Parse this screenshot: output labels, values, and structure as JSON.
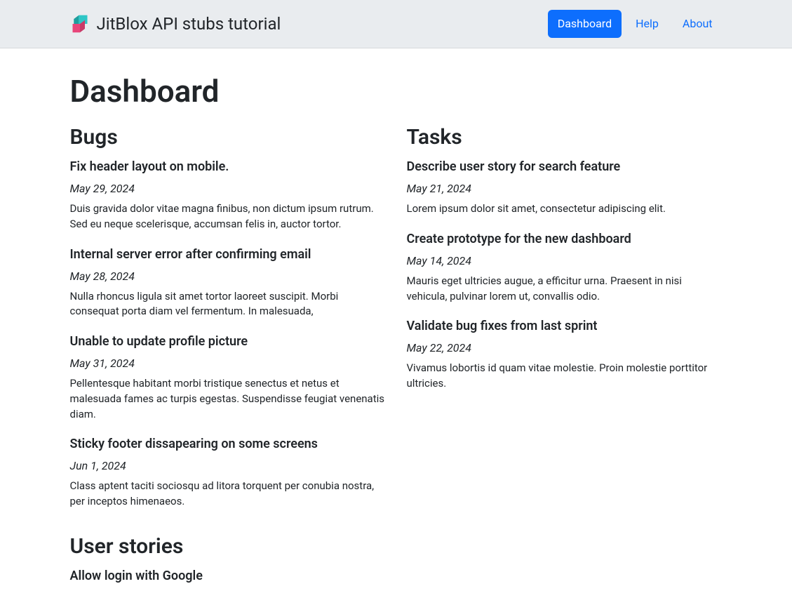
{
  "header": {
    "brand": "JitBlox API stubs tutorial",
    "nav": {
      "dashboard": "Dashboard",
      "help": "Help",
      "about": "About"
    }
  },
  "page": {
    "title": "Dashboard"
  },
  "sections": {
    "bugs": {
      "heading": "Bugs",
      "items": [
        {
          "title": "Fix header layout on mobile.",
          "date": "May 29, 2024",
          "desc": "Duis gravida dolor vitae magna finibus, non dictum ipsum rutrum. Sed eu neque scelerisque, accumsan felis in, auctor tortor."
        },
        {
          "title": "Internal server error after confirming email",
          "date": "May 28, 2024",
          "desc": "Nulla rhoncus ligula sit amet tortor laoreet suscipit. Morbi consequat porta diam vel fermentum. In malesuada,"
        },
        {
          "title": "Unable to update profile picture",
          "date": "May 31, 2024",
          "desc": "Pellentesque habitant morbi tristique senectus et netus et malesuada fames ac turpis egestas. Suspendisse feugiat venenatis diam."
        },
        {
          "title": "Sticky footer dissapearing on some screens",
          "date": "Jun 1, 2024",
          "desc": "Class aptent taciti sociosqu ad litora torquent per conubia nostra, per inceptos himenaeos."
        }
      ]
    },
    "user_stories": {
      "heading": "User stories",
      "items": [
        {
          "title": "Allow login with Google",
          "date": "",
          "desc": ""
        }
      ]
    },
    "tasks": {
      "heading": "Tasks",
      "items": [
        {
          "title": "Describe user story for search feature",
          "date": "May 21, 2024",
          "desc": "Lorem ipsum dolor sit amet, consectetur adipiscing elit."
        },
        {
          "title": "Create prototype for the new dashboard",
          "date": "May 14, 2024",
          "desc": "Mauris eget ultricies augue, a efficitur urna. Praesent in nisi vehicula, pulvinar lorem ut, convallis odio."
        },
        {
          "title": "Validate bug fixes from last sprint",
          "date": "May 22, 2024",
          "desc": "Vivamus lobortis id quam vitae molestie. Proin molestie porttitor ultricies."
        }
      ]
    }
  }
}
